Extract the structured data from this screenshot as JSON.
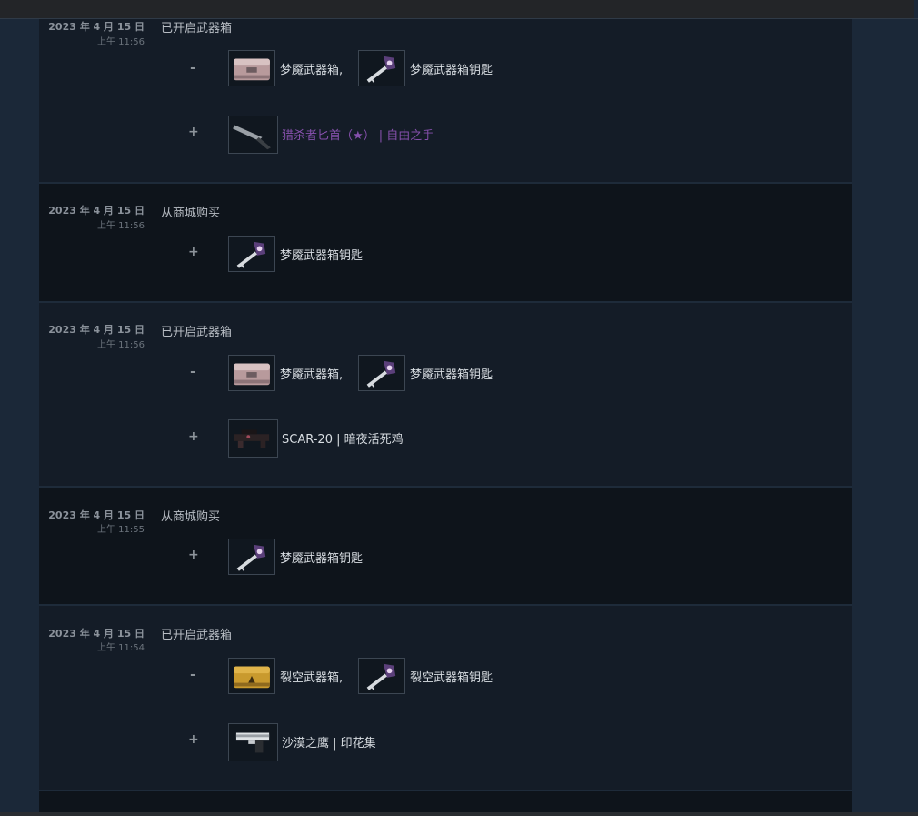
{
  "history": [
    {
      "date": "2023 年 4 月 15 日",
      "time": "上午 11:56",
      "action": "已开启武器箱",
      "removed": [
        {
          "name": "梦魇武器箱",
          "separator": ",",
          "icon": "case-icon",
          "color": "#b89a9c"
        },
        {
          "name": "梦魇武器箱钥匙",
          "icon": "key-icon"
        }
      ],
      "added": [
        {
          "name": "猎杀者匕首（★） | 自由之手",
          "icon": "knife-icon",
          "color": "#8650ac"
        }
      ]
    },
    {
      "date": "2023 年 4 月 15 日",
      "time": "上午 11:56",
      "action": "从商城购买",
      "added": [
        {
          "name": "梦魇武器箱钥匙",
          "icon": "key-icon"
        }
      ]
    },
    {
      "date": "2023 年 4 月 15 日",
      "time": "上午 11:56",
      "action": "已开启武器箱",
      "removed": [
        {
          "name": "梦魇武器箱",
          "separator": ",",
          "icon": "case-icon",
          "color": "#b89a9c"
        },
        {
          "name": "梦魇武器箱钥匙",
          "icon": "key-icon"
        }
      ],
      "added": [
        {
          "name": "SCAR-20 | 暗夜活死鸡",
          "icon": "rifle-icon"
        }
      ]
    },
    {
      "date": "2023 年 4 月 15 日",
      "time": "上午 11:55",
      "action": "从商城购买",
      "added": [
        {
          "name": "梦魇武器箱钥匙",
          "icon": "key-icon"
        }
      ]
    },
    {
      "date": "2023 年 4 月 15 日",
      "time": "上午 11:54",
      "action": "已开启武器箱",
      "removed": [
        {
          "name": "裂空武器箱",
          "separator": ",",
          "icon": "case-icon",
          "color": "#c99a2e"
        },
        {
          "name": "裂空武器箱钥匙",
          "icon": "key-icon"
        }
      ],
      "added": [
        {
          "name": "沙漠之鹰 | 印花集",
          "icon": "pistol-icon"
        }
      ]
    }
  ],
  "signs": {
    "removed": "-",
    "added": "+"
  }
}
